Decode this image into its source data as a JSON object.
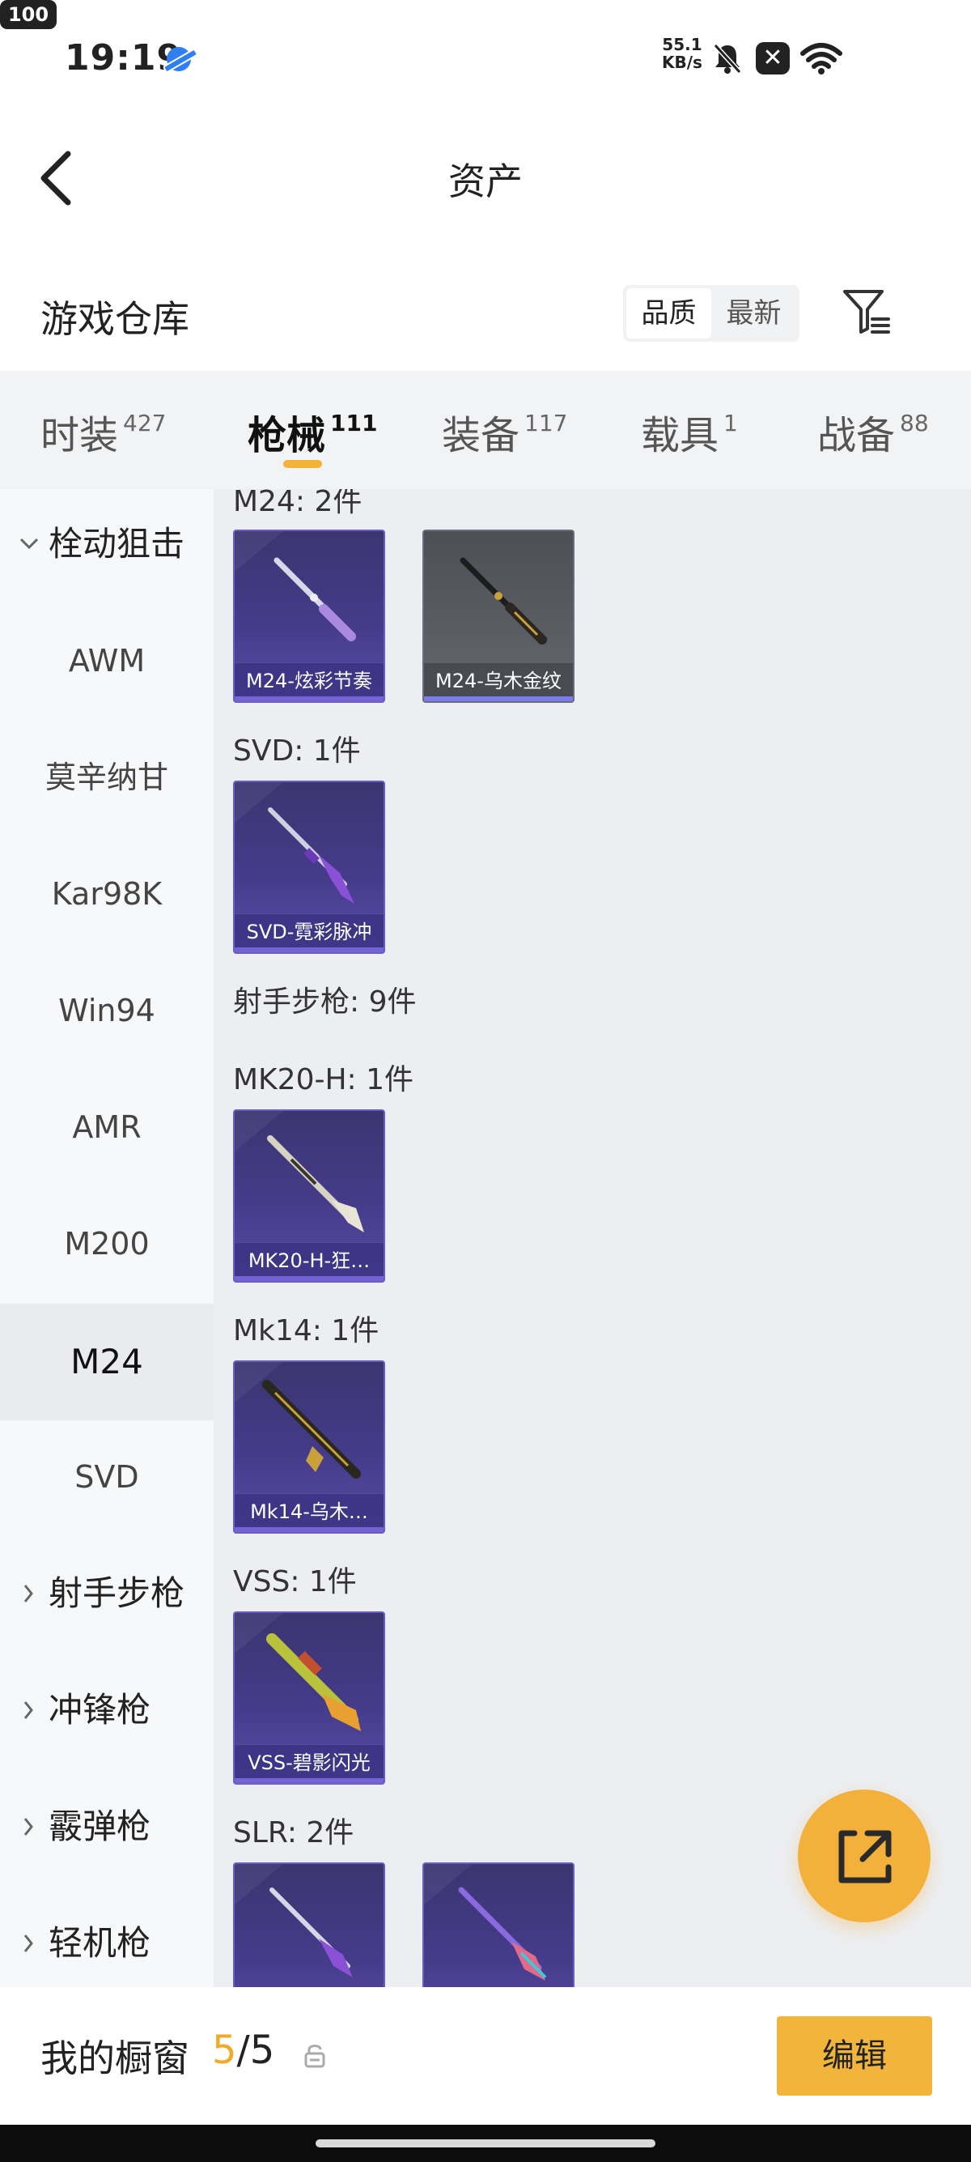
{
  "status_bar": {
    "time": "19:19",
    "net_speed_value": "55.1",
    "net_speed_unit": "KB/s",
    "battery": "100"
  },
  "header": {
    "title": "资产"
  },
  "section": {
    "title": "游戏仓库",
    "sort_options": [
      "品质",
      "最新"
    ],
    "active_sort": "品质"
  },
  "tabs": [
    {
      "label": "时装",
      "count": "427"
    },
    {
      "label": "枪械",
      "count": "111",
      "active": true
    },
    {
      "label": "装备",
      "count": "117"
    },
    {
      "label": "载具",
      "count": "1"
    },
    {
      "label": "战备",
      "count": "88"
    }
  ],
  "sidebar": {
    "group_open": "栓动狙击",
    "items": [
      "AWM",
      "莫辛纳甘",
      "Kar98K",
      "Win94",
      "AMR",
      "M200",
      "M24",
      "SVD"
    ],
    "active_item": "M24",
    "groups_collapsed": [
      "射手步枪",
      "冲锋枪",
      "霰弹枪",
      "轻机枪"
    ]
  },
  "content": {
    "categories": [
      {
        "label": "M24: 2件",
        "cards": [
          {
            "name": "M24-炫彩节奏",
            "style": "purple"
          },
          {
            "name": "M24-乌木金纹",
            "style": "gray"
          }
        ]
      },
      {
        "label": "SVD: 1件",
        "cards": [
          {
            "name": "SVD-霓彩脉冲",
            "style": "purple"
          }
        ]
      },
      {
        "label": "射手步枪: 9件"
      },
      {
        "label": "MK20-H: 1件",
        "cards": [
          {
            "name": "MK20-H-狂…",
            "style": "purple"
          }
        ]
      },
      {
        "label": "Mk14: 1件",
        "cards": [
          {
            "name": "Mk14-乌木…",
            "style": "purple"
          }
        ]
      },
      {
        "label": "VSS: 1件",
        "cards": [
          {
            "name": "VSS-碧影闪光",
            "style": "purple"
          }
        ]
      },
      {
        "label": "SLR: 2件"
      }
    ]
  },
  "bottom_bar": {
    "label": "我的橱窗",
    "current": "5",
    "separator": "/",
    "total": "5",
    "edit_label": "编辑"
  },
  "colors": {
    "accent": "#f2b53c",
    "card_purple": "#453b8a",
    "card_gray": "#5b5d64"
  }
}
